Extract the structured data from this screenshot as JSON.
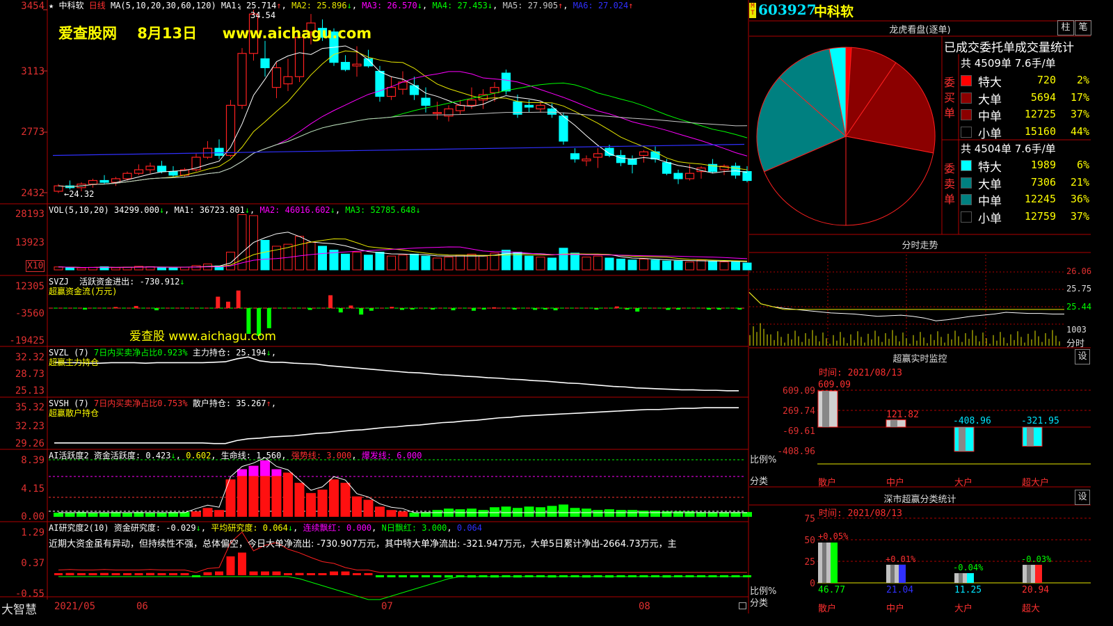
{
  "header": {
    "symbol_star": "★",
    "stock_name": "中科软",
    "period": "日线",
    "ma_label": "MA(5,10,20,30,60,120)",
    "ma1": "MA1: 25.714",
    "ma2": "MA2: 25.896",
    "ma3": "MA3: 26.570",
    "ma4": "MA4: 27.453",
    "ma5": "MA5: 27.905",
    "ma6": "MA6: 27.024",
    "ma1_arrow": "↑",
    "ma2_arrow": "↓",
    "ma3_arrow": "↓",
    "ma4_arrow": "↓",
    "ma5_arrow": "↑",
    "ma6_arrow": "↑",
    "high_mark": "34.54",
    "low_mark": "←24.32",
    "watermark": "爱查股网    8月13日     www.aichagu.com",
    "watermark2": "爱查股 www.aichagu.com",
    "bottom_brand": "大智慧"
  },
  "colors": {
    "up": "#ff2020",
    "down": "#00ffff",
    "grid": "#b00000",
    "axis": "#e03030",
    "ma1": "#ffffff",
    "ma2": "#e8e800",
    "ma3": "#ff00ff",
    "ma4": "#00ff00",
    "ma5": "#c8c8c8",
    "ma6": "#3030ff"
  },
  "axes": {
    "price_ticks": [
      "3454",
      "3113",
      "2773",
      "2432"
    ],
    "vol_ticks": [
      "28193",
      "13923",
      "X10"
    ],
    "svzj_ticks": [
      "12305",
      "-3560",
      "-19425"
    ],
    "svzl_ticks": [
      "32.32",
      "28.73",
      "25.13"
    ],
    "svsh_ticks": [
      "35.32",
      "32.23",
      "29.26"
    ],
    "ai1_ticks": [
      "8.39",
      "4.15",
      "0.00"
    ],
    "ai2_ticks": [
      "1.29",
      "0.37",
      "-0.55"
    ],
    "date_labels": [
      "2021/05",
      "06",
      "07",
      "08"
    ]
  },
  "panels": {
    "vol": {
      "title": "VOL(5,10,20)",
      "value": "34299.000",
      "ma1": "MA1: 36723.801",
      "ma2": "MA2: 46016.602",
      "ma3": "MA3: 52785.648",
      "a0": "↓",
      "a1": "↓",
      "a2": "↓",
      "a3": "↓"
    },
    "svzj": {
      "title": "SVZJ",
      "desc": "活跃资金进出: -730.912",
      "arrow": "↓",
      "sub": "超赢资金流(万元)"
    },
    "svzl": {
      "title": "SVZL (7)",
      "desc": "7日内买卖净占比0.923%",
      "hold": "主力持仓: 25.194",
      "arrow": "↓",
      "sub": "超赢主力持仓"
    },
    "svsh": {
      "title": "SVSH (7)",
      "desc": "7日内买卖净占比0.753%",
      "hold": "散户持仓: 35.267",
      "arrow": "↑",
      "sub": "超赢散户持仓"
    },
    "ai1": {
      "title": "AI活跃度2",
      "v1": "资金活跃度: 0.423",
      "v2": "0.602",
      "v3": "生命线: 1.560",
      "v4": "强势线: 3.000",
      "v5": "爆发线: 6.000",
      "a1": "↓",
      "a2": ","
    },
    "ai2": {
      "title": "AI研究度2(10)",
      "v1": "资金研究度: -0.029",
      "v2": "平均研究度: 0.064",
      "v3": "连续飘红: 0.000",
      "v4": "N日飘红: 3.000",
      "v5": "0.064",
      "a1": "↓",
      "a2": "↓",
      "comment": "近期大资金虽有异动，但持续性不强，总体偏空，今日大单净流出: -730.907万元，其中特大单净流出: -321.947万元，大单5日累计净出-2664.73万元，主"
    }
  },
  "right": {
    "code": "603927",
    "name": "中科软",
    "mt_badge": "M T",
    "dragon_title": "龙虎看盘(逐单)",
    "btn_zhu": "柱",
    "btn_bi": "笔",
    "table_head": "已成交委托单成交量统计",
    "buy_total": "共 4509单 7.6手/单",
    "sell_total": "共 4504单 7.6手/单",
    "buy_side": "委买单",
    "sell_side": "委卖单",
    "buy_rows": [
      {
        "label": "特大",
        "count": "720",
        "pct": "2%",
        "color": "#ff0000"
      },
      {
        "label": "大单",
        "count": "5694",
        "pct": "17%",
        "color": "#8b0000"
      },
      {
        "label": "中单",
        "count": "12725",
        "pct": "37%",
        "color": "#8b0000"
      },
      {
        "label": "小单",
        "count": "15160",
        "pct": "44%",
        "color": "#000000"
      }
    ],
    "sell_rows": [
      {
        "label": "特大",
        "count": "1989",
        "pct": "6%",
        "color": "#00ffff"
      },
      {
        "label": "大单",
        "count": "7306",
        "pct": "21%",
        "color": "#008080"
      },
      {
        "label": "中单",
        "count": "12245",
        "pct": "36%",
        "color": "#008080"
      },
      {
        "label": "小单",
        "count": "12759",
        "pct": "37%",
        "color": "#000000"
      }
    ],
    "intraday_title": "分时走势",
    "intraday_ticks": [
      "26.06",
      "25.75",
      "25.44",
      "1003"
    ],
    "intraday_foot": "分时",
    "monitor_title": "超赢实时监控",
    "monitor_btn": "设",
    "monitor_time": "时间: 2021/08/13",
    "monitor_ticks": [
      "609.09",
      "269.74",
      "-69.61",
      "-408.96"
    ],
    "monitor_axis_label": "比例%",
    "monitor_cat_label": "分类",
    "monitor_cats": [
      "散户",
      "中户",
      "大户",
      "超大户"
    ],
    "monitor_values": [
      "609.09",
      "121.82",
      "-408.96",
      "-321.95"
    ],
    "stats_title": "深市超赢分类统计",
    "stats_btn": "设",
    "stats_time": "时间: 2021/08/13",
    "stats_ticks": [
      "75",
      "50",
      "25",
      "0"
    ],
    "stats_axis_label": "比例%",
    "stats_cat_label": "分类",
    "stats_cats": [
      "散户",
      "中户",
      "大户",
      "超大"
    ],
    "stats_values": [
      "46.77",
      "21.04",
      "11.25",
      "20.94"
    ],
    "stats_deltas": [
      "+0.05%",
      "+0.01%",
      "-0.04%",
      "-0.03%"
    ]
  },
  "chart_data": [
    {
      "type": "candlestick",
      "title": "中科软 日线",
      "ylim": [
        24.0,
        35.3
      ],
      "ohlc": [
        [
          24.4,
          24.8,
          24.3,
          24.7
        ],
        [
          24.7,
          25.0,
          24.5,
          24.6
        ],
        [
          24.6,
          24.9,
          24.4,
          24.8
        ],
        [
          24.8,
          25.1,
          24.6,
          25.0
        ],
        [
          25.0,
          25.3,
          24.8,
          24.9
        ],
        [
          24.9,
          25.2,
          24.7,
          25.1
        ],
        [
          25.1,
          25.5,
          25.0,
          25.4
        ],
        [
          25.4,
          25.9,
          25.3,
          25.6
        ],
        [
          25.6,
          26.0,
          25.4,
          25.8
        ],
        [
          25.8,
          26.1,
          25.4,
          25.5
        ],
        [
          25.5,
          25.8,
          25.2,
          25.3
        ],
        [
          25.3,
          25.7,
          25.2,
          25.6
        ],
        [
          25.6,
          26.5,
          25.5,
          26.3
        ],
        [
          26.3,
          27.2,
          26.2,
          26.8
        ],
        [
          26.8,
          27.3,
          26.2,
          26.4
        ],
        [
          26.4,
          29.5,
          26.3,
          29.2
        ],
        [
          29.2,
          32.4,
          29.0,
          32.1
        ],
        [
          32.1,
          34.54,
          31.7,
          34.3
        ],
        [
          31.8,
          32.8,
          30.8,
          31.3
        ],
        [
          30.2,
          31.6,
          29.6,
          31.3
        ],
        [
          30.4,
          31.8,
          30.0,
          30.8
        ],
        [
          30.8,
          33.1,
          30.5,
          33.0
        ],
        [
          33.3,
          34.3,
          32.6,
          33.8
        ],
        [
          33.5,
          34.0,
          32.8,
          33.0
        ],
        [
          33.3,
          33.5,
          31.4,
          31.6
        ],
        [
          31.6,
          32.0,
          31.1,
          31.2
        ],
        [
          31.4,
          32.5,
          30.8,
          31.5
        ],
        [
          31.8,
          32.3,
          31.3,
          31.4
        ],
        [
          31.1,
          31.4,
          29.4,
          29.7
        ],
        [
          29.7,
          30.8,
          29.5,
          30.2
        ],
        [
          30.1,
          31.1,
          29.8,
          30.5
        ],
        [
          30.3,
          30.8,
          29.5,
          29.8
        ],
        [
          29.6,
          30.2,
          28.8,
          29.2
        ],
        [
          28.8,
          29.4,
          28.4,
          28.8
        ],
        [
          28.6,
          29.2,
          28.3,
          29.0
        ],
        [
          28.9,
          29.5,
          28.7,
          29.2
        ],
        [
          29.2,
          30.2,
          29.0,
          29.5
        ],
        [
          29.5,
          30.1,
          29.0,
          29.8
        ],
        [
          29.9,
          30.5,
          29.4,
          30.2
        ],
        [
          31.0,
          31.2,
          29.8,
          30.0
        ],
        [
          29.4,
          29.8,
          28.5,
          28.7
        ],
        [
          29.2,
          29.5,
          28.8,
          29.1
        ],
        [
          29.0,
          29.4,
          28.8,
          29.2
        ],
        [
          29.0,
          29.3,
          28.5,
          28.7
        ],
        [
          28.6,
          28.8,
          27.0,
          27.2
        ],
        [
          26.5,
          26.8,
          26.0,
          26.2
        ],
        [
          26.1,
          26.4,
          25.8,
          26.2
        ],
        [
          26.3,
          26.8,
          25.7,
          26.5
        ],
        [
          26.8,
          27.0,
          26.3,
          26.4
        ],
        [
          26.4,
          26.7,
          25.8,
          26.0
        ],
        [
          26.2,
          26.4,
          25.4,
          25.9
        ],
        [
          26.4,
          26.7,
          26.0,
          26.6
        ],
        [
          26.6,
          26.9,
          26.0,
          26.2
        ],
        [
          26.0,
          26.2,
          25.3,
          25.4
        ],
        [
          25.4,
          25.6,
          24.8,
          25.1
        ],
        [
          25.1,
          25.9,
          25.0,
          25.4
        ],
        [
          25.5,
          25.8,
          25.1,
          25.7
        ],
        [
          25.9,
          26.2,
          25.4,
          25.5
        ],
        [
          25.6,
          25.9,
          25.3,
          25.8
        ],
        [
          25.8,
          26.0,
          25.1,
          25.3
        ],
        [
          25.5,
          25.8,
          24.9,
          25.0
        ]
      ]
    },
    {
      "type": "bar",
      "title": "VOL(5,10,20)",
      "values": [
        1.5,
        1.2,
        1.0,
        1.3,
        1.6,
        1.1,
        1.4,
        1.8,
        1.6,
        1.3,
        1.0,
        1.4,
        2.2,
        3.0,
        2.0,
        9.0,
        28.0,
        27.5,
        15.0,
        12.0,
        13.0,
        17.0,
        14.0,
        12.0,
        10.0,
        8.0,
        9.0,
        7.5,
        9.0,
        7.0,
        7.5,
        8.0,
        7.0,
        6.0,
        6.5,
        7.5,
        8.0,
        7.0,
        8.5,
        10.0,
        9.0,
        7.0,
        6.5,
        6.0,
        11.0,
        8.5,
        6.5,
        7.0,
        6.0,
        5.5,
        5.0,
        5.5,
        5.0,
        4.5,
        4.5,
        4.0,
        5.0,
        4.5,
        4.0,
        4.0,
        3.5
      ]
    },
    {
      "type": "bar",
      "title": "SVZJ 超赢资金流(万元)",
      "values": [
        0,
        0,
        0,
        -300,
        0,
        0,
        800,
        0,
        1500,
        0,
        -1500,
        0,
        0,
        0,
        0,
        0,
        8000,
        4500,
        12300,
        -18000,
        -19400,
        -14000,
        0,
        0,
        0,
        -1200,
        0,
        9000,
        -3000,
        1800,
        -4500,
        -1800,
        0,
        900,
        -1200,
        -600,
        0,
        -900,
        0,
        -1500,
        0,
        -1800,
        -900,
        600,
        0,
        -600,
        0,
        -1200,
        -900,
        -1500,
        0,
        0,
        0,
        -900,
        0,
        1200,
        -1000,
        -2400,
        0,
        0,
        -1200,
        -600,
        0,
        0,
        -700,
        -500,
        0,
        -900
      ]
    },
    {
      "type": "line",
      "title": "SVZL 超赢主力持仓",
      "ylim": [
        25.13,
        32.32
      ],
      "values": [
        31.2,
        31.1,
        31.1,
        31.0,
        31.0,
        31.1,
        31.1,
        31.1,
        31.0,
        31.1,
        31.1,
        31.1,
        31.1,
        31.1,
        31.2,
        31.3,
        31.9,
        32.3,
        31.5,
        31.2,
        31.2,
        31.0,
        30.9,
        30.8,
        30.5,
        30.3,
        30.1,
        29.9,
        29.7,
        29.5,
        29.3,
        29.1,
        29.0,
        28.8,
        28.6,
        28.5,
        28.3,
        28.2,
        28.0,
        27.9,
        27.7,
        27.6,
        27.4,
        27.3,
        27.1,
        26.9,
        26.8,
        26.6,
        26.4,
        26.2,
        26.1,
        25.9,
        25.8,
        25.7,
        25.6,
        25.5,
        25.5,
        25.4,
        25.4,
        25.3,
        25.3
      ]
    },
    {
      "type": "line",
      "title": "SVSH 超赢散户持仓",
      "ylim": [
        29.26,
        35.32
      ],
      "values": [
        29.4,
        29.4,
        29.4,
        29.4,
        29.4,
        29.4,
        29.4,
        29.4,
        29.4,
        29.4,
        29.4,
        29.4,
        29.4,
        29.4,
        29.3,
        29.3,
        29.8,
        30.1,
        30.2,
        30.4,
        30.5,
        30.6,
        30.8,
        31.0,
        31.1,
        31.3,
        31.5,
        31.6,
        31.8,
        32.0,
        32.1,
        32.3,
        32.4,
        32.6,
        32.8,
        32.9,
        33.1,
        33.2,
        33.4,
        33.6,
        33.7,
        33.9,
        34.0,
        34.1,
        34.2,
        34.3,
        34.4,
        34.5,
        34.6,
        34.7,
        34.8,
        34.9,
        35.0,
        35.0,
        35.1,
        35.2,
        35.2,
        35.3,
        35.3,
        35.3,
        35.3
      ]
    },
    {
      "type": "bar",
      "title": "AI活跃度2",
      "ylim": [
        0,
        8.39
      ],
      "values": [
        -0.4,
        -0.4,
        -0.5,
        -0.4,
        -0.4,
        -0.5,
        -0.4,
        -0.5,
        -0.4,
        -0.4,
        -0.5,
        -0.5,
        0.8,
        1.3,
        1.0,
        5.5,
        7.0,
        7.5,
        8.3,
        7.0,
        6.5,
        5.0,
        3.5,
        4.0,
        5.5,
        5.0,
        3.0,
        2.5,
        1.5,
        1.0,
        0.8,
        -0.4,
        -0.5,
        -0.8,
        -1.0,
        -0.9,
        -1.0,
        -0.8,
        -1.2,
        -1.3,
        -1.1,
        -1.3,
        -1.2,
        -1.4,
        -1.6,
        -1.1,
        -1.0,
        -0.8,
        -0.9,
        -0.8,
        -0.8,
        -0.7,
        -0.7,
        -0.6,
        -0.6,
        -0.6,
        -0.5,
        -0.5,
        -0.5,
        -0.5,
        -0.5
      ]
    },
    {
      "type": "bar",
      "title": "AI研究度2(10)",
      "ylim": [
        -0.55,
        1.29
      ],
      "values": [
        0.05,
        0.06,
        0.05,
        0.05,
        0.06,
        0.05,
        0.05,
        0.05,
        0.06,
        0.05,
        0.05,
        0.05,
        -0.05,
        0.08,
        0.1,
        0.5,
        0.6,
        0.1,
        0.1,
        0.1,
        0.05,
        0.06,
        0.05,
        0.05,
        0.1,
        0.1,
        0.05,
        0.05,
        -0.05,
        -0.05,
        -0.05,
        -0.05,
        -0.05,
        -0.05,
        -0.06,
        -0.05,
        -0.06,
        -0.05,
        -0.06,
        -0.05,
        -0.06,
        -0.05,
        -0.05,
        -0.06,
        -0.05,
        -0.05,
        -0.06,
        -0.05,
        -0.06,
        -0.05,
        -0.05,
        -0.05,
        -0.05,
        -0.06,
        -0.05,
        -0.05,
        -0.05,
        -0.05,
        -0.05,
        -0.05,
        -0.05
      ]
    },
    {
      "type": "pie",
      "title": "龙虎看盘(逐单)",
      "slices": [
        {
          "name": "买特大",
          "value": 2,
          "color": "#ff0000"
        },
        {
          "name": "买大单",
          "value": 17,
          "color": "#8b0000"
        },
        {
          "name": "买中单",
          "value": 37,
          "color": "#8b0000"
        },
        {
          "name": "买小单",
          "value": 44,
          "color": "#000000"
        },
        {
          "name": "卖小单",
          "value": 37,
          "color": "#000000"
        },
        {
          "name": "卖中单",
          "value": 36,
          "color": "#008080"
        },
        {
          "name": "卖大单",
          "value": 21,
          "color": "#008080"
        },
        {
          "name": "卖特大",
          "value": 6,
          "color": "#00ffff"
        }
      ]
    },
    {
      "type": "line",
      "title": "分时走势",
      "ylim": [
        25.1,
        26.1
      ],
      "values": [
        25.7,
        25.5,
        25.45,
        25.42,
        25.4,
        25.38,
        25.36,
        25.34,
        25.33,
        25.32,
        25.3,
        25.28,
        25.29,
        25.3,
        25.28,
        25.25,
        25.2,
        25.22,
        25.25,
        25.28,
        25.3,
        25.32,
        25.35,
        25.34,
        25.33,
        25.33,
        25.32,
        25.32
      ]
    },
    {
      "type": "bar",
      "title": "超赢实时监控",
      "categories": [
        "散户",
        "中户",
        "大户",
        "超大户"
      ],
      "values": [
        609.09,
        121.82,
        -408.96,
        -321.95
      ]
    },
    {
      "type": "bar",
      "title": "深市超赢分类统计",
      "categories": [
        "散户",
        "中户",
        "大户",
        "超大"
      ],
      "values": [
        46.77,
        21.04,
        11.25,
        20.94
      ]
    }
  ]
}
